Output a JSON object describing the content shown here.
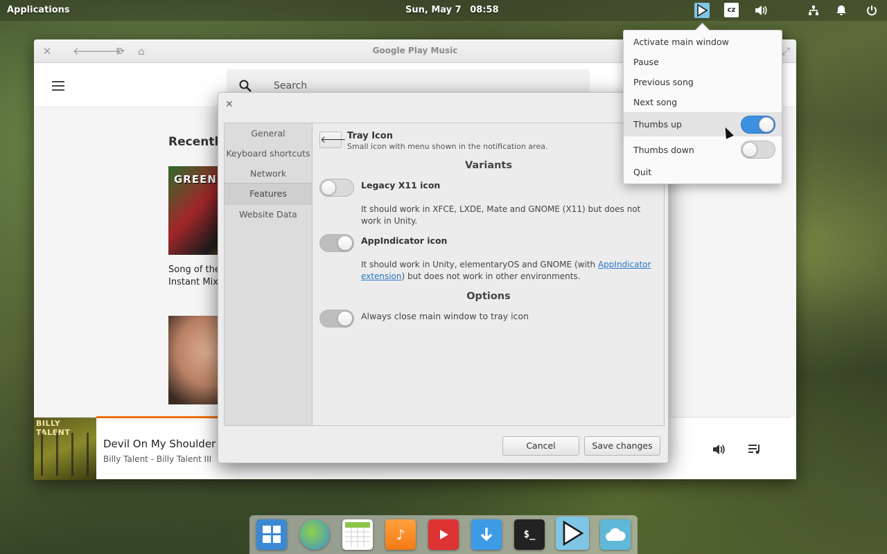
{
  "panel": {
    "applications": "Applications",
    "date": "Sun, May 7",
    "time": "08:58",
    "keyboard_layout": "cz",
    "indicators": [
      "play-icon",
      "keyboard-layout",
      "volume-icon",
      "network-icon",
      "notification-bell-icon",
      "power-icon"
    ]
  },
  "window": {
    "title": "Google Play Music"
  },
  "app": {
    "search_placeholder": "Search",
    "recently_heading": "Recently",
    "album1_cover_text": "GREEN",
    "album1_caption_line1": "Song of the",
    "album1_caption_line2": "Instant Mix"
  },
  "nowplaying": {
    "title": "Devil On My Shoulder",
    "artist_album": "Billy Talent - Billy Talent III",
    "cover_text": "BILLY TALENT"
  },
  "dialog": {
    "sidebar": [
      "General",
      "Keyboard shortcuts",
      "Network",
      "Features",
      "Website Data"
    ],
    "active_sidebar": "Features",
    "header_title": "Tray Icon",
    "header_subtitle": "Small icon with menu shown in the notification area.",
    "variants_heading": "Variants",
    "legacy_title": "Legacy X11 icon",
    "legacy_desc": "It should work in XFCE, LXDE, Mate and GNOME (X11) but does not work in Unity.",
    "appind_title": "AppIndicator icon",
    "appind_desc_pre": "It should work in Unity, elementaryOS and GNOME (with ",
    "appind_link": "AppIndicator extension",
    "appind_desc_post": ") but does not work in other environments.",
    "options_heading": "Options",
    "always_close_label": "Always close main window to tray icon",
    "toggles": {
      "legacy": false,
      "appindicator": true,
      "always_close": true
    },
    "cancel": "Cancel",
    "save": "Save changes"
  },
  "tray_menu": {
    "items": [
      "Activate main window",
      "Pause",
      "Previous song",
      "Next song",
      "Thumbs up",
      "Thumbs down",
      "Quit"
    ],
    "thumbs_up_on": true,
    "thumbs_down_on": false
  },
  "dock": {
    "apps": [
      "multitasking-view",
      "web-browser",
      "calendar",
      "music",
      "videos",
      "app-center",
      "terminal",
      "google-play-music",
      "cloud"
    ]
  },
  "colors": {
    "accent_blue": "#3d8fe0",
    "progress_orange": "#ef6c00",
    "link": "#2a76c6"
  }
}
